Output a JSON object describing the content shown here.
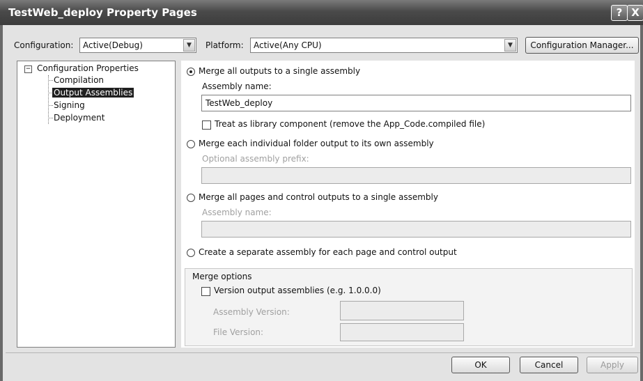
{
  "window": {
    "title": "TestWeb_deploy Property Pages",
    "help_glyph": "?",
    "close_glyph": "X"
  },
  "toolbar": {
    "configuration_label": "Configuration:",
    "configuration_value": "Active(Debug)",
    "platform_label": "Platform:",
    "platform_value": "Active(Any CPU)",
    "configuration_manager_label": "Configuration Manager..."
  },
  "tree": {
    "root_label": "Configuration Properties",
    "root_expander": "−",
    "items": [
      {
        "label": "Compilation",
        "selected": false
      },
      {
        "label": "Output Assemblies",
        "selected": true
      },
      {
        "label": "Signing",
        "selected": false
      },
      {
        "label": "Deployment",
        "selected": false
      }
    ]
  },
  "output": {
    "option1_label": "Merge all outputs to a single assembly",
    "option1_selected": true,
    "option1_name_label": "Assembly name:",
    "option1_name_value": "TestWeb_deploy",
    "library_checkbox_label": "Treat as library component (remove the App_Code.compiled file)",
    "library_checked": false,
    "option2_label": "Merge each individual folder output to its own assembly",
    "option2_prefix_label": "Optional assembly prefix:",
    "option2_prefix_value": "",
    "option3_label": "Merge all pages and control outputs to a single assembly",
    "option3_name_label": "Assembly name:",
    "option3_name_value": "",
    "option4_label": "Create a separate assembly for each page and control output"
  },
  "merge_options": {
    "group_label": "Merge options",
    "version_checkbox_label": "Version output assemblies (e.g. 1.0.0.0)",
    "version_checked": false,
    "assembly_version_label": "Assembly Version:",
    "assembly_version_value": "",
    "file_version_label": "File Version:",
    "file_version_value": ""
  },
  "footer": {
    "ok_label": "OK",
    "cancel_label": "Cancel",
    "apply_label": "Apply"
  }
}
